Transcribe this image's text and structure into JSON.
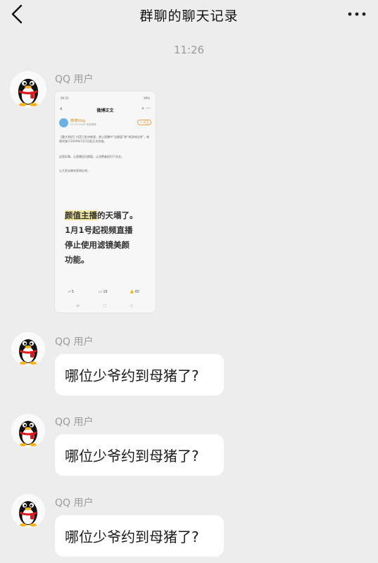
{
  "header": {
    "title": "群聊的聊天记录"
  },
  "chat": {
    "time": "11:26",
    "messages": [
      {
        "sender": "QQ 用户",
        "type": "image"
      },
      {
        "sender": "QQ 用户",
        "type": "text",
        "text": "哪位少爷约到母猪了?"
      },
      {
        "sender": "QQ 用户",
        "type": "text",
        "text": "哪位少爷约到母猪了?"
      },
      {
        "sender": "QQ 用户",
        "type": "text",
        "text": "哪位少爷约到母猪了?"
      }
    ]
  },
  "shared_image": {
    "status_left": "09:55",
    "status_right": "99%",
    "nav_title": "微博正文",
    "author": "微博Vlog",
    "author_meta": "12-24 10:05 来自微博",
    "follow_label": "+ 关注",
    "p1": "【重大利好】抖音已发布新规，禁止直播中“比颜值”和“拼身材比拼”，新规实施于2020年1月1日起正式实施。",
    "p2": "这是好事，让直播回归颜值，让消费者回归下实业。",
    "p3": "让大家去做宅家网红吧。",
    "quote_highlight": "颜值主播",
    "quote_rest": "的天塌了。",
    "quote_line2": "1月1号起视频直播",
    "quote_line3": "停止使用滤镜美颜",
    "quote_line4": "功能。",
    "reposts": "5",
    "comments": "16",
    "likes": "65"
  },
  "icons": {
    "back": "chevron-left-icon",
    "more": "more-dots-icon",
    "avatar": "qq-penguin-icon"
  }
}
